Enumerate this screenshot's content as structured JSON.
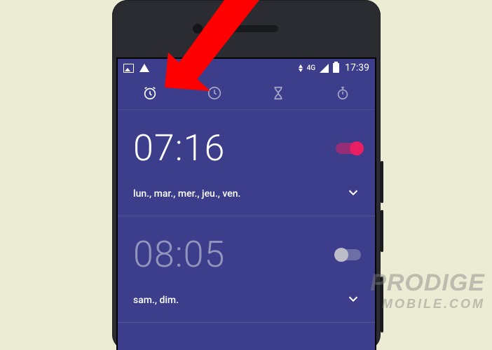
{
  "statusbar": {
    "network_label": "4G",
    "time": "17:39"
  },
  "tabs": {
    "alarm": "Alarm",
    "clock": "Clock",
    "timer": "Timer",
    "stopwatch": "Stopwatch",
    "active": "alarm"
  },
  "alarms": [
    {
      "time": "07:16",
      "days": "lun., mar., mer., jeu., ven.",
      "enabled": true
    },
    {
      "time": "08:05",
      "days": "sam., dim.",
      "enabled": false
    }
  ],
  "watermark": {
    "line1": "PRODIGE",
    "line2": "MOBILE.COM"
  }
}
